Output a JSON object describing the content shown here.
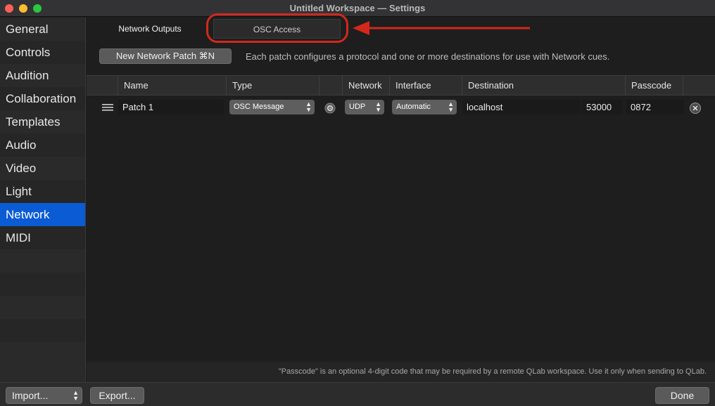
{
  "window": {
    "title": "Untitled Workspace — Settings"
  },
  "sidebar": {
    "items": [
      {
        "label": "General",
        "selected": false
      },
      {
        "label": "Controls",
        "selected": false
      },
      {
        "label": "Audition",
        "selected": false
      },
      {
        "label": "Collaboration",
        "selected": false
      },
      {
        "label": "Templates",
        "selected": false
      },
      {
        "label": "Audio",
        "selected": false
      },
      {
        "label": "Video",
        "selected": false
      },
      {
        "label": "Light",
        "selected": false
      },
      {
        "label": "Network",
        "selected": true
      },
      {
        "label": "MIDI",
        "selected": false
      }
    ]
  },
  "tabs": {
    "outputs": "Network Outputs",
    "osc": "OSC Access"
  },
  "toolbar": {
    "new_patch": "New Network Patch  ⌘N",
    "hint": "Each patch configures a protocol and one or more destinations for use with Network cues."
  },
  "table": {
    "headers": {
      "name": "Name",
      "type": "Type",
      "network": "Network",
      "interface": "Interface",
      "destination": "Destination",
      "passcode": "Passcode"
    },
    "rows": [
      {
        "name": "Patch 1",
        "type": "OSC Message",
        "network": "UDP",
        "interface": "Automatic",
        "destination": "localhost",
        "port": "53000",
        "passcode": "0872"
      }
    ]
  },
  "footer_note": "\"Passcode\" is an optional 4-digit code that may be required by a remote QLab workspace. Use it only when sending to QLab.",
  "bottom": {
    "import": "Import...",
    "export": "Export...",
    "done": "Done"
  },
  "colors": {
    "accent": "#0a5bd4",
    "annotation": "#d2281c"
  }
}
